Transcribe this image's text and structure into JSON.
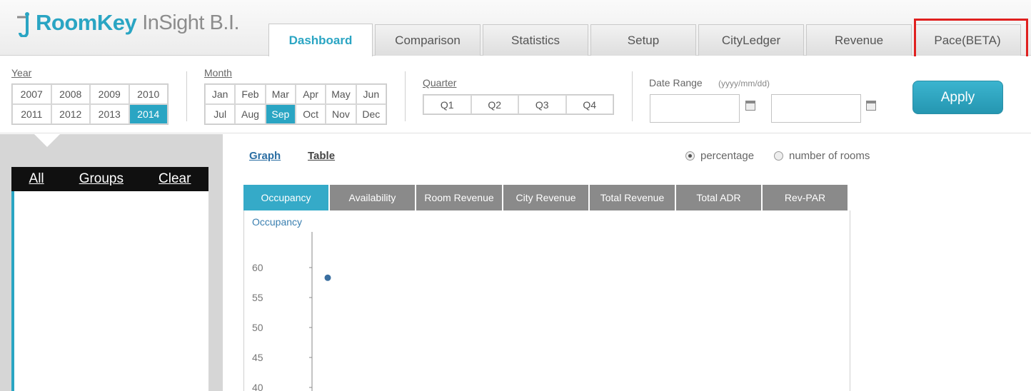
{
  "app": {
    "brand": "RoomKey",
    "product": "InSight B.I."
  },
  "tabs": [
    {
      "label": "Dashboard",
      "active": true
    },
    {
      "label": "Comparison"
    },
    {
      "label": "Statistics"
    },
    {
      "label": "Setup"
    },
    {
      "label": "CityLedger"
    },
    {
      "label": "Revenue"
    },
    {
      "label": "Pace(BETA)",
      "highlighted": true
    }
  ],
  "filters": {
    "year": {
      "label": "Year",
      "options": [
        "2007",
        "2008",
        "2009",
        "2010",
        "2011",
        "2012",
        "2013",
        "2014"
      ],
      "selected": "2014"
    },
    "month": {
      "label": "Month",
      "options": [
        "Jan",
        "Feb",
        "Mar",
        "Apr",
        "May",
        "Jun",
        "Jul",
        "Aug",
        "Sep",
        "Oct",
        "Nov",
        "Dec"
      ],
      "selected": "Sep"
    },
    "quarter": {
      "label": "Quarter",
      "options": [
        "Q1",
        "Q2",
        "Q3",
        "Q4"
      ]
    },
    "date_range": {
      "label": "Date Range",
      "format_hint": "(yyyy/mm/dd)",
      "start_value": "",
      "end_value": ""
    },
    "apply_label": "Apply"
  },
  "groups_panel": {
    "all": "All",
    "groups": "Groups",
    "clear": "Clear"
  },
  "view": {
    "graph_label": "Graph",
    "table_label": "Table",
    "percentage_label": "percentage",
    "rooms_label": "number of rooms",
    "selected_mode": "percentage"
  },
  "metric_tabs": [
    {
      "label": "Occupancy",
      "active": true
    },
    {
      "label": "Availability"
    },
    {
      "label": "Room Revenue"
    },
    {
      "label": "City Revenue"
    },
    {
      "label": "Total Revenue"
    },
    {
      "label": "Total ADR"
    },
    {
      "label": "Rev-PAR"
    }
  ],
  "colors": {
    "accent": "#2aa5c3",
    "highlight_box": "#e0201f",
    "point": "#3a6fa0"
  },
  "chart_data": {
    "type": "scatter",
    "title": "Occupancy",
    "y_ticks": [
      60,
      55,
      50,
      45,
      40
    ],
    "ylim": [
      40,
      60
    ],
    "series": [
      {
        "values": [
          {
            "x": 1,
            "y": 58.3
          }
        ]
      }
    ]
  }
}
